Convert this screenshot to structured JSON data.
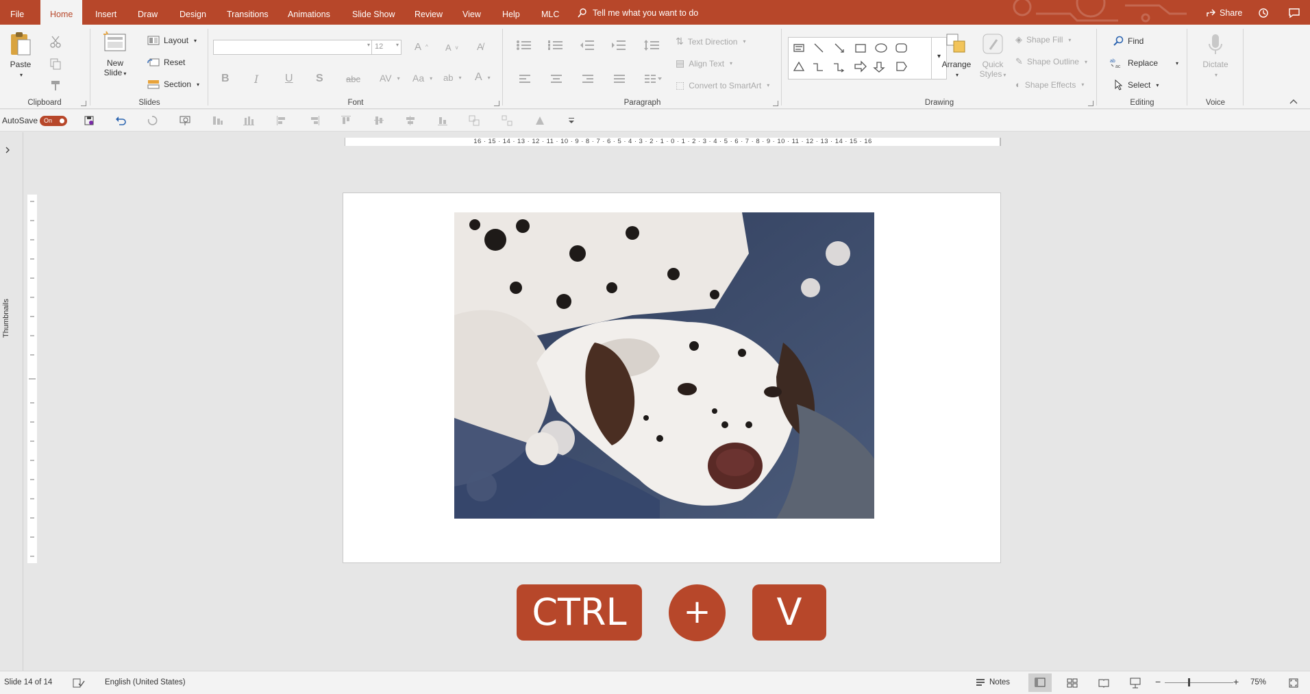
{
  "tabs": [
    {
      "label": "File",
      "active": false
    },
    {
      "label": "Home",
      "active": true
    },
    {
      "label": "Insert",
      "active": false
    },
    {
      "label": "Draw",
      "active": false
    },
    {
      "label": "Design",
      "active": false
    },
    {
      "label": "Transitions",
      "active": false
    },
    {
      "label": "Animations",
      "active": false
    },
    {
      "label": "Slide Show",
      "active": false
    },
    {
      "label": "Review",
      "active": false
    },
    {
      "label": "View",
      "active": false
    },
    {
      "label": "Help",
      "active": false
    },
    {
      "label": "MLC",
      "active": false
    }
  ],
  "tell_me": "Tell me what you want to do",
  "share_label": "Share",
  "ribbon": {
    "clipboard": {
      "label": "Clipboard",
      "paste": "Paste"
    },
    "slides": {
      "label": "Slides",
      "new_slide_line1": "New",
      "new_slide_line2": "Slide",
      "layout": "Layout",
      "reset": "Reset",
      "section": "Section"
    },
    "font": {
      "label": "Font",
      "font_size": "12",
      "font_name": ""
    },
    "paragraph": {
      "label": "Paragraph",
      "text_direction": "Text Direction",
      "align_text": "Align Text",
      "convert_smartart": "Convert to SmartArt"
    },
    "drawing": {
      "label": "Drawing",
      "arrange": "Arrange",
      "quick_styles_line1": "Quick",
      "quick_styles_line2": "Styles",
      "shape_fill": "Shape Fill",
      "shape_outline": "Shape Outline",
      "shape_effects": "Shape Effects"
    },
    "editing": {
      "label": "Editing",
      "find": "Find",
      "replace": "Replace",
      "select": "Select"
    },
    "voice": {
      "label": "Voice",
      "dictate": "Dictate"
    }
  },
  "qat": {
    "autosave_label": "AutoSave",
    "autosave_state": "On"
  },
  "thumbnails_label": "Thumbnails",
  "hruler_ticks": "16 · 15 · 14 · 13 · 12 · 11 · 10 · 9 · 8 · 7 · 6 · 5 · 4 · 3 · 2 · 1 · 0 · 1 · 2 · 3 · 4 · 5 · 6 · 7 · 8 · 9 · 10 · 11 · 12 · 13 · 14 · 15 · 16",
  "shortcut": {
    "key1": "CTRL",
    "plus": "+",
    "key2": "V"
  },
  "status": {
    "slide_count": "Slide 14 of 14",
    "language": "English (United States)",
    "notes": "Notes",
    "zoom": "75%"
  },
  "colors": {
    "accent": "#b7472a",
    "ribbon_bg": "#f3f3f3",
    "workspace_bg": "#e6e6e6"
  }
}
